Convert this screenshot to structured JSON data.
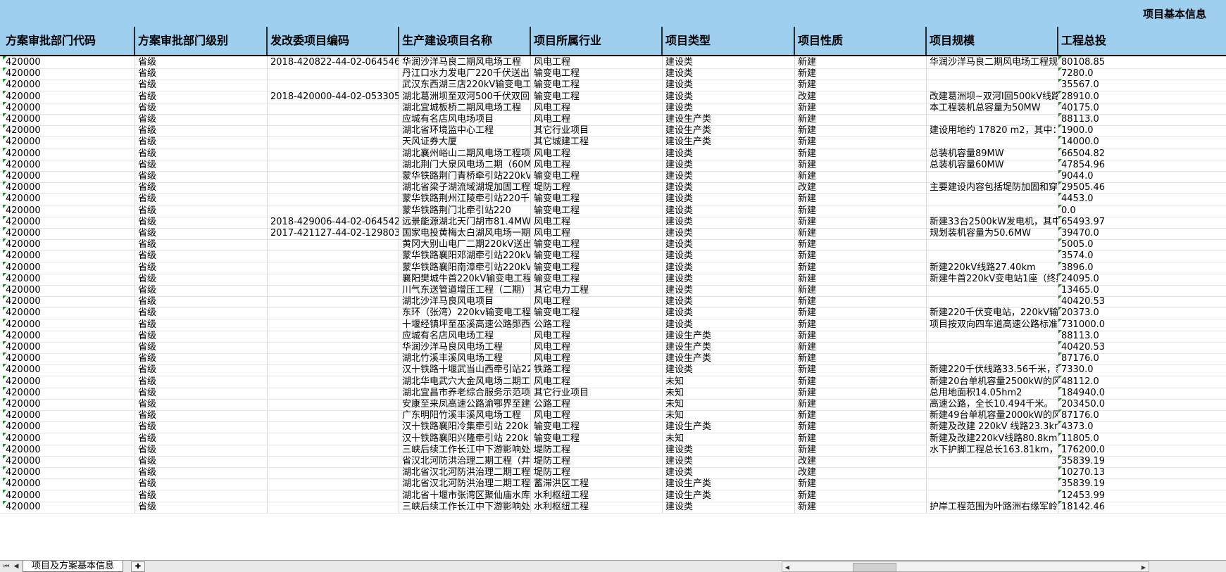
{
  "sheet_title": "项目基本信息",
  "headers": [
    "方案审批部门代码",
    "方案审批部门级别",
    "发改委项目编码",
    "生产建设项目名称",
    "项目所属行业",
    "项目类型",
    "项目性质",
    "项目规模",
    "工程总投"
  ],
  "rows": [
    [
      "420000",
      "省级",
      "2018-420822-44-02-064546",
      "华润沙洋马良二期风电场工程",
      "风电工程",
      "建设类",
      "新建",
      "华润沙洋马良二期风电场工程规",
      "80108.85"
    ],
    [
      "420000",
      "省级",
      "",
      "丹江口水力发电厂220千伏送出",
      "输变电工程",
      "建设类",
      "新建",
      "",
      "7280.0"
    ],
    [
      "420000",
      "省级",
      "",
      "武汉东西湖三店220kV输变电工",
      "输变电工程",
      "建设类",
      "新建",
      "",
      "35567.0"
    ],
    [
      "420000",
      "省级",
      "2018-420000-44-02-053305",
      "湖北葛洲坝至双河500千伏双回",
      "输变电工程",
      "建设类",
      "改建",
      "改建葛洲坝~双河Ⅰ回500kV线路",
      "28910.0"
    ],
    [
      "420000",
      "省级",
      "",
      "湖北宜城板桥二期风电场工程",
      "风电工程",
      "建设类",
      "新建",
      "本工程装机总容量为50MW",
      "40175.0"
    ],
    [
      "420000",
      "省级",
      "",
      "应城有名店风电场项目",
      "风电工程",
      "建设生产类",
      "新建",
      "",
      "88113.0"
    ],
    [
      "420000",
      "省级",
      "",
      "湖北省环境监中心工程",
      "其它行业项目",
      "建设生产类",
      "新建",
      "建设用地约 17820 m2，其中：",
      "1900.0"
    ],
    [
      "420000",
      "省级",
      "",
      "天风证券大厦",
      "其它城建工程",
      "建设生产类",
      "新建",
      "",
      "14000.0"
    ],
    [
      "420000",
      "省级",
      "",
      "湖北襄州峪山二期风电场工程项",
      "风电工程",
      "建设类",
      "新建",
      "总装机容量89MW",
      "66504.82"
    ],
    [
      "420000",
      "省级",
      "",
      "湖北荆门大泉风电场二期（60M",
      "风电工程",
      "建设类",
      "新建",
      "总装机容量60MW",
      "47854.96"
    ],
    [
      "420000",
      "省级",
      "",
      "蒙华铁路荆门青桥牵引站220kV",
      "输变电工程",
      "建设类",
      "新建",
      "",
      "9044.0"
    ],
    [
      "420000",
      "省级",
      "",
      "湖北省梁子湖流域湖堤加固工程",
      "堤防工程",
      "建设类",
      "改建",
      "主要建设内容包括堤防加固和穿",
      "29505.46"
    ],
    [
      "420000",
      "省级",
      "",
      "蒙华铁路荆州江陵牵引站220千",
      "输变电工程",
      "建设类",
      "新建",
      "",
      "4453.0"
    ],
    [
      "420000",
      "省级",
      "",
      "蒙华铁路荆门北牵引站220",
      "输变电工程",
      "建设类",
      "新建",
      "",
      "0.0"
    ],
    [
      "420000",
      "省级",
      "2018-429006-44-02-064542",
      "远景能源湖北天门胡市81.4MW风",
      "风电工程",
      "建设类",
      "新建",
      "新建33台2500kW发电机，其中-",
      "65493.97"
    ],
    [
      "420000",
      "省级",
      "2017-421127-44-02-129803",
      "国家电投黄梅太白湖风电场一期",
      "风电工程",
      "建设类",
      "新建",
      "规划装机容量为50.6MW",
      "39470.0"
    ],
    [
      "420000",
      "省级",
      "",
      "黄冈大别山电厂二期220kV送出",
      "输变电工程",
      "建设类",
      "新建",
      "",
      "5005.0"
    ],
    [
      "420000",
      "省级",
      "",
      "蒙华铁路襄阳邓湖牵引站220kV",
      "输变电工程",
      "建设类",
      "新建",
      "",
      "3574.0"
    ],
    [
      "420000",
      "省级",
      "",
      "蒙华铁路襄阳南漳牵引站220kV",
      "输变电工程",
      "建设类",
      "新建",
      "新建220kV线路27.40km",
      "3896.0"
    ],
    [
      "420000",
      "省级",
      "",
      "襄阳樊城牛首220kV输变电工程",
      "输变电工程",
      "建设类",
      "新建",
      "新建牛首220kV变电站1座（终期",
      "24095.0"
    ],
    [
      "420000",
      "省级",
      "",
      "川气东送管道增压工程（二期）",
      "其它电力工程",
      "建设类",
      "新建",
      "",
      "13465.0"
    ],
    [
      "420000",
      "省级",
      "",
      "湖北沙洋马良风电项目",
      "风电工程",
      "建设类",
      "新建",
      "",
      "40420.53"
    ],
    [
      "420000",
      "省级",
      "",
      "东环（张湾）220kv输变电工程",
      "输变电工程",
      "建设类",
      "新建",
      "新建220千伏变电站，220kV输电",
      "20373.0"
    ],
    [
      "420000",
      "省级",
      "",
      "十堰经镇坪至巫溪高速公路郧西",
      "公路工程",
      "建设类",
      "新建",
      "项目按双向四车道高速公路标准",
      "731000.0"
    ],
    [
      "420000",
      "省级",
      "",
      "应城有名店风电场工程",
      "风电工程",
      "建设生产类",
      "新建",
      "",
      "88113.0"
    ],
    [
      "420000",
      "省级",
      "",
      "华润沙洋马良风电场工程",
      "风电工程",
      "建设生产类",
      "新建",
      "",
      "40420.53"
    ],
    [
      "420000",
      "省级",
      "",
      "湖北竹溪丰溪风电场工程",
      "风电工程",
      "建设生产类",
      "新建",
      "",
      "87176.0"
    ],
    [
      "420000",
      "省级",
      "",
      "汉十铁路十堰武当山西牵引站22",
      "铁路工程",
      "建设类",
      "新建",
      "新建220千伏线路33.56千米，新",
      "7330.0"
    ],
    [
      "420000",
      "省级",
      "",
      "湖北华电武穴大金风电场二期工",
      "风电工程",
      "未知",
      "新建",
      "新建20台单机容量2500kW的风力",
      "48112.0"
    ],
    [
      "420000",
      "省级",
      "",
      "湖北宜昌市养老综合服务示范项",
      "其它行业项目",
      "未知",
      "新建",
      "总用地面积14.05hm2",
      "184940.0"
    ],
    [
      "420000",
      "省级",
      "",
      "安康至来凤高速公路渝鄂界至建",
      "公路工程",
      "未知",
      "新建",
      "高速公路，全长10.494千米。",
      "203450.0"
    ],
    [
      "420000",
      "省级",
      "",
      "广东明阳竹溪丰溪风电场工程",
      "风电工程",
      "未知",
      "新建",
      "新建49台单机容量2000kW的风力",
      "87176.0"
    ],
    [
      "420000",
      "省级",
      "",
      "汉十铁路襄阳冷集牵引站 220k",
      "输变电工程",
      "建设生产类",
      "新建",
      "新建及改建 220kV 线路23.3km",
      "4373.0"
    ],
    [
      "420000",
      "省级",
      "",
      "汉十铁路襄阳兴隆牵引站 220k",
      "输变电工程",
      "未知",
      "新建",
      "新建及改建220kV线路80.8km，",
      "11805.0"
    ],
    [
      "420000",
      "省级",
      "",
      "三峡后续工作长江中下游影响处",
      "堤防工程",
      "建设类",
      "新建",
      "水下护脚工程总长163.81km，2",
      "176200.0"
    ],
    [
      "420000",
      "省级",
      "",
      "省汉北河防洪治理二期工程（井",
      "堤防工程",
      "建设类",
      "改建",
      "",
      "35839.19"
    ],
    [
      "420000",
      "省级",
      "",
      "湖北省汉北河防洪治理二期工程",
      "堤防工程",
      "建设类",
      "改建",
      "",
      "10270.13"
    ],
    [
      "420000",
      "省级",
      "",
      "湖北省汉北河防洪治理二期工程",
      "蓄滞洪区工程",
      "建设生产类",
      "新建",
      "",
      "35839.19"
    ],
    [
      "420000",
      "省级",
      "",
      "湖北省十堰市张湾区聚仙庙水库",
      "水利枢纽工程",
      "建设生产类",
      "新建",
      "",
      "12453.99"
    ],
    [
      "420000",
      "省级",
      "",
      "三峡后续工作长江中下游影响处",
      "水利枢纽工程",
      "建设类",
      "新建",
      "护岸工程范围为叶路洲右缘军岭",
      "18142.46"
    ]
  ],
  "sheet_tabs": [
    "项目及方案基本信息"
  ],
  "nav_icons": [
    "first-sheet-icon",
    "prev-sheet-icon",
    "next-sheet-icon",
    "last-sheet-icon"
  ],
  "colors": {
    "header_bg": "#9fcfef",
    "indicator": "#1f8a1f"
  }
}
